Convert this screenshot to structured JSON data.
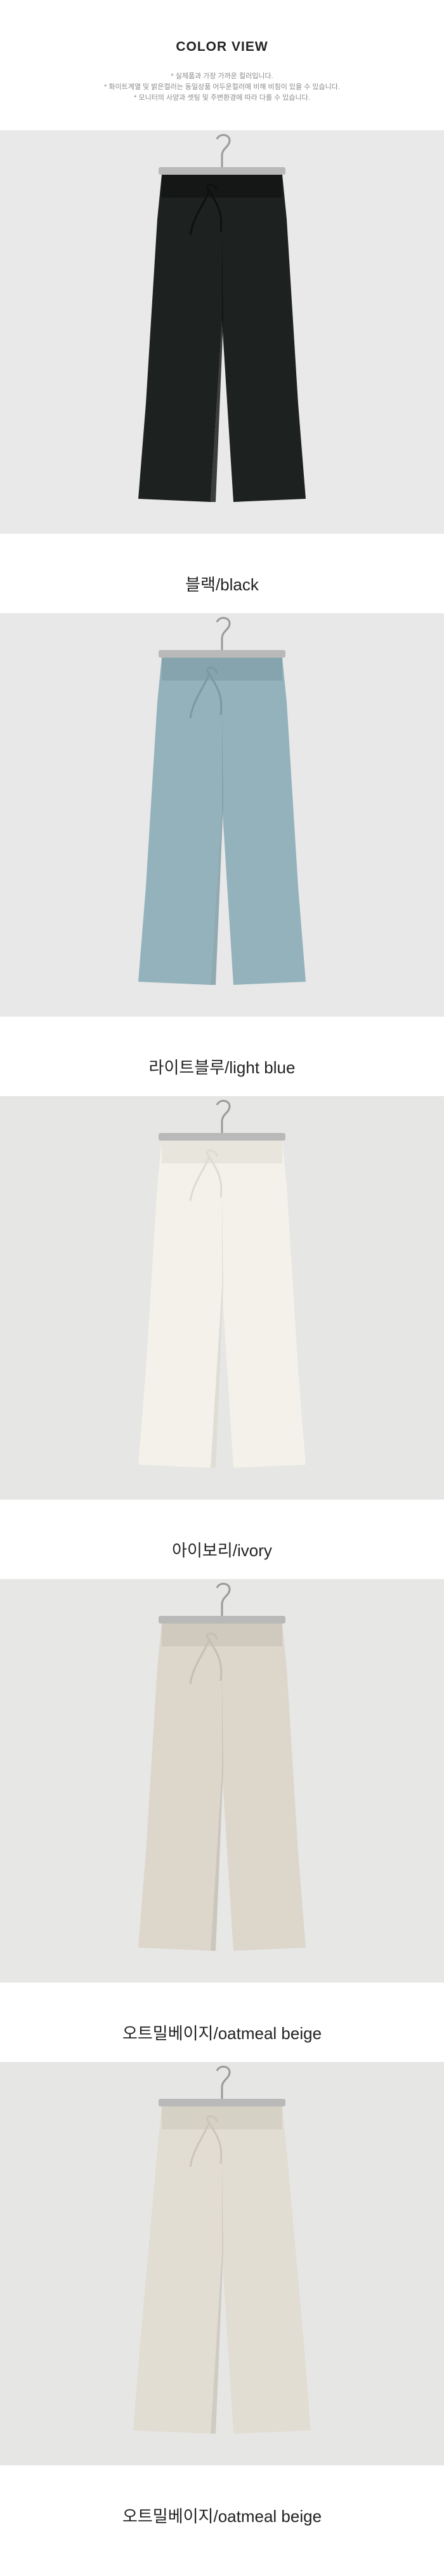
{
  "header": {
    "title": "COLOR VIEW",
    "notes": [
      "* 실제품과 가장 가까운 컬러입니다.",
      "* 화이트계열 및 밝은컬러는 동일상품 어두운컬러에 비해 비침이 있을 수 있습니다.",
      "* 모니터의 사양과 셋팅 및 주변환경에 따라 다를 수 있습니다."
    ]
  },
  "colors": [
    {
      "label": "블랙/black",
      "fabric": "#1d211f",
      "shade": "#0e1110",
      "bg": "#e9e9e9"
    },
    {
      "label": "라이트블루/light blue",
      "fabric": "#94b2bc",
      "shade": "#7a99a3",
      "bg": "#e8e8e8"
    },
    {
      "label": "아이보리/ivory",
      "fabric": "#f3f1ea",
      "shade": "#dedbd1",
      "bg": "#e6e6e4"
    },
    {
      "label": "오트밀베이지/oatmeal beige",
      "fabric": "#dcd6cb",
      "shade": "#c6bfb2",
      "bg": "#e7e7e6"
    },
    {
      "label": "오트밀베이지/oatmeal beige",
      "fabric": "#e2ddd2",
      "shade": "#ccc6b9",
      "bg": "#e6e6e5"
    }
  ]
}
